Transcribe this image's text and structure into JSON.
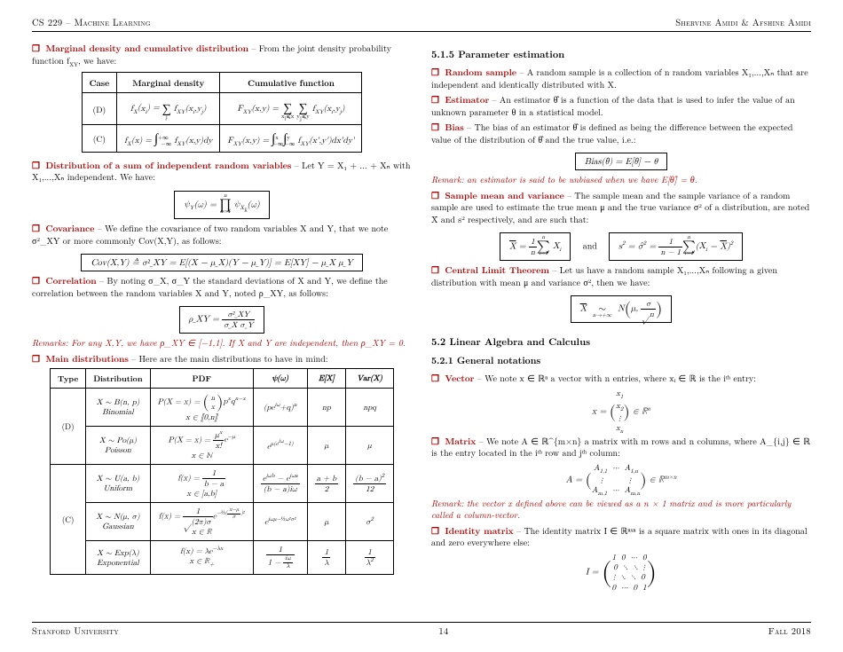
{
  "header": {
    "left": "CS 229 – Machine Learning",
    "right": "Shervine Amidi & Afshine Amidi"
  },
  "footer": {
    "left": "Stanford University",
    "center": "14",
    "right": "Fall 2018"
  },
  "left": {
    "marginal_title": "Marginal density and cumulative distribution",
    "marginal_text": " – From the joint density probability function f",
    "marginal_text2": ", we have:",
    "table1": {
      "h1": "Case",
      "h2": "Marginal density",
      "h3": "Cumulative function",
      "r1c1": "(D)",
      "r1c2": "fₓ(xᵢ) = Σⱼ f_XY(xᵢ,yⱼ)",
      "r1c3": "F_XY(x,y) = Σ_{xᵢ≤x} Σ_{yⱼ≤y} f_XY(xᵢ,yⱼ)",
      "r2c1": "(C)",
      "r2c2_a": "fₓ(x) = ",
      "r2c2_int": "∫",
      "r2c2_lims": "−∞..+∞",
      "r2c2_b": " f_XY(x,y)dy",
      "r2c3_a": "F_XY(x,y) = ",
      "r2c3_b": " f_XY(x',y')dx'dy'"
    },
    "dist_sum_title": "Distribution of a sum of independent random variables",
    "dist_sum_text": " – Let Y = X₁ + ... + Xₙ with X₁,...,Xₙ independent. We have:",
    "dist_sum_eq": "ψ_Y(ω) = ∏_{k=1}^{n} ψ_{X_k}(ω)",
    "cov_title": "Covariance",
    "cov_text": " – We define the covariance of two random variables X and Y, that we note σ²_XY or more commonly Cov(X,Y), as follows:",
    "cov_eq": "Cov(X,Y) ≜ σ²_XY = E[(X − μ_X)(Y − μ_Y)] = E[XY] − μ_X μ_Y",
    "corr_title": "Correlation",
    "corr_text": " – By noting σ_X, σ_Y the standard deviations of X and Y, we define the correlation between the random variables X and Y, noted ρ_XY, as follows:",
    "corr_eq_num": "σ²_XY",
    "corr_eq_den": "σ_X σ_Y",
    "corr_eq_lhs": "ρ_XY = ",
    "corr_remark": "Remarks: For any X,Y, we have ρ_XY ∈ [−1,1]. If X and Y are independent, then ρ_XY = 0.",
    "main_dist_title": "Main distributions",
    "main_dist_text": " – Here are the main distributions to have in mind:",
    "table2": {
      "h1": "Type",
      "h2": "Distribution",
      "h3": "PDF",
      "h4": "ψ(ω)",
      "h5": "E[X]",
      "h6": "Var(X)",
      "rows": [
        {
          "type": "(D)",
          "dist": "X ∼ B(n, p)\nBinomial",
          "pdf": "P(X = x) = (n choose x) pˣqⁿ⁻ˣ\nx ∈ ⟦0,n⟧",
          "psi": "(pe^{iω}+q)ⁿ",
          "ex": "np",
          "var": "npq"
        },
        {
          "type": "",
          "dist": "X ∼ Po(μ)\nPoisson",
          "pdf": "P(X = x) = (μˣ/x!) e^{−μ}\nx ∈ ℕ",
          "psi": "e^{μ(e^{iω}−1)}",
          "ex": "μ",
          "var": "μ"
        },
        {
          "type": "(C)",
          "dist": "X ∼ U(a, b)\nUniform",
          "pdf": "f(x) = 1/(b−a)\nx ∈ [a,b]",
          "psi": "(e^{iωb}−e^{iωa})/((b−a)iω)",
          "ex": "(a+b)/2",
          "var": "(b−a)²/12"
        },
        {
          "type": "",
          "dist": "X ∼ N(μ, σ)\nGaussian",
          "pdf": "f(x) = (1/√(2π)σ) e^{−½((x−μ)/σ)²}\nx ∈ ℝ",
          "psi": "e^{iωμ−½ω²σ²}",
          "ex": "μ",
          "var": "σ²"
        },
        {
          "type": "",
          "dist": "X ∼ Exp(λ)\nExponential",
          "pdf": "f(x) = λe^{−λx}\nx ∈ ℝ₊",
          "psi": "1/(1 − iω/λ)",
          "ex": "1/λ",
          "var": "1/λ²"
        }
      ]
    }
  },
  "right": {
    "sec515": "5.1.5    Parameter estimation",
    "rand_title": "Random sample",
    "rand_text": " – A random sample is a collection of n random variables X₁,...,Xₙ that are independent and identically distributed with X.",
    "est_title": "Estimator",
    "est_text": " – An estimator θ̂ is a function of the data that is used to infer the value of an unknown parameter θ in a statistical model.",
    "bias_title": "Bias",
    "bias_text": " – The bias of an estimator θ̂ is defined as being the difference between the expected value of the distribution of θ̂ and the true value, i.e.:",
    "bias_eq": "Bias(θ̂) = E[θ̂] − θ",
    "bias_remark": "Remark: an estimator is said to be unbiased when we have E[θ̂] = θ.",
    "smv_title": "Sample mean and variance",
    "smv_text": " – The sample mean and the sample variance of a random sample are used to estimate the true mean μ and the true variance σ² of a distribution, are noted X̄ and s² respectively, and are such that:",
    "smv_and": "and",
    "smv_eq1_lhs": "X̄ = ",
    "smv_eq1_frac_num": "1",
    "smv_eq1_frac_den": "n",
    "smv_eq1_sum": "Σ_{i=1}^{n} Xᵢ",
    "smv_eq2": "s² = σ̂² = (1/(n−1)) Σ_{i=1}^{n} (Xᵢ − X̄)²",
    "clt_title": "Central Limit Theorem",
    "clt_text": " – Let us have a random sample X₁,...,Xₙ following a given distribution with mean μ and variance σ², then we have:",
    "clt_eq": "X̄  ∼_{n→+∞}  N(μ, σ/√n)",
    "sec52": "5.2    Linear Algebra and Calculus",
    "sec521": "5.2.1    General notations",
    "vec_title": "Vector",
    "vec_text": " – We note x ∈ ℝⁿ a vector with n entries, where xᵢ ∈ ℝ is the iᵗʰ entry:",
    "vec_eq_entries": "x₁\nx₂\n⋮\nxₙ",
    "vec_eq_suffix": " ∈ ℝⁿ",
    "mat_title": "Matrix",
    "mat_text": " – We note A ∈ ℝ^{m×n} a matrix with m rows and n columns, where A_{i,j} ∈ ℝ is the entry located in the iᵗʰ row and jᵗʰ column:",
    "mat_eq_rows": "A₁,₁  ···  A₁,ₙ\n⋮         ⋮\nA_{m,1}  ···  A_{m,n}",
    "mat_eq_suffix": " ∈ ℝ^{m×n}",
    "mat_remark": "Remark: the vector x defined above can be viewed as a n × 1 matrix and is more particularly called a column-vector.",
    "id_title": "Identity matrix",
    "id_text": " – The identity matrix I ∈ ℝⁿˣⁿ is a square matrix with ones in its diagonal and zero everywhere else:",
    "id_eq": "I = ( 1 0 ··· 0 ; 0 ⋱ ⋱ ⋮ ; ⋮ ⋱ ⋱ 0 ; 0 ··· 0 1 )"
  },
  "chart_data": {
    "type": "table",
    "marginal_cumulative": {
      "columns": [
        "Case",
        "Marginal density",
        "Cumulative function"
      ],
      "rows": [
        [
          "(D)",
          "f_X(x_i)=Σ_j f_XY(x_i,y_j)",
          "F_XY(x,y)=Σ_{x_i≤x}Σ_{y_j≤y} f_XY(x_i,y_j)"
        ],
        [
          "(C)",
          "f_X(x)=∫_{-∞}^{+∞} f_XY(x,y)dy",
          "F_XY(x,y)=∫_{-∞}^{x}∫_{-∞}^{y} f_XY(x',y')dx'dy'"
        ]
      ]
    },
    "main_distributions": {
      "columns": [
        "Type",
        "Distribution",
        "PDF",
        "ψ(ω)",
        "E[X]",
        "Var(X)"
      ],
      "rows": [
        [
          "(D)",
          "Binomial B(n,p)",
          "P(X=x)=(n x)p^x q^{n-x}, x∈⟦0,n⟧",
          "(pe^{iω}+q)^n",
          "np",
          "npq"
        ],
        [
          "(D)",
          "Poisson Po(μ)",
          "P(X=x)=μ^x/x! e^{-μ}, x∈ℕ",
          "e^{μ(e^{iω}-1)}",
          "μ",
          "μ"
        ],
        [
          "(C)",
          "Uniform U(a,b)",
          "f(x)=1/(b-a), x∈[a,b]",
          "(e^{iωb}-e^{iωa})/((b-a)iω)",
          "(a+b)/2",
          "(b-a)^2/12"
        ],
        [
          "(C)",
          "Gaussian N(μ,σ)",
          "f(x)=1/(√(2π)σ) e^{-½((x-μ)/σ)^2}, x∈ℝ",
          "e^{iωμ-½ω^2σ^2}",
          "μ",
          "σ^2"
        ],
        [
          "(C)",
          "Exponential Exp(λ)",
          "f(x)=λe^{-λx}, x∈ℝ_+",
          "1/(1-iω/λ)",
          "1/λ",
          "1/λ^2"
        ]
      ]
    }
  }
}
